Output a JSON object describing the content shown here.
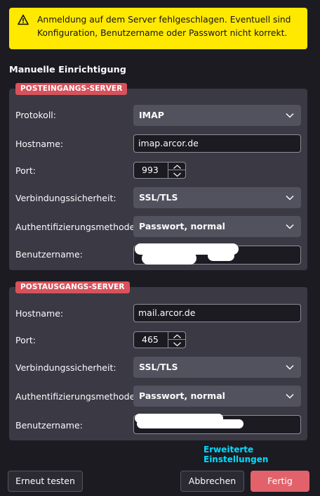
{
  "notice": {
    "text": "Anmeldung auf dem Server fehlgeschlagen. Eventuell sind Konfiguration, Benutzername oder Passwort nicht korrekt."
  },
  "heading": "Manuelle Einrichtigung",
  "incoming": {
    "badge": "POSTEINGANGS-SERVER",
    "protocol_label": "Protokoll:",
    "protocol_value": "IMAP",
    "hostname_label": "Hostname:",
    "hostname_value": "imap.arcor.de",
    "port_label": "Port:",
    "port_value": "993",
    "security_label": "Verbindungssicherheit:",
    "security_value": "SSL/TLS",
    "auth_label": "Authentifizierungsmethode:",
    "auth_value": "Passwort, normal",
    "username_label": "Benutzername:"
  },
  "outgoing": {
    "badge": "POSTAUSGANGS-SERVER",
    "hostname_label": "Hostname:",
    "hostname_value": "mail.arcor.de",
    "port_label": "Port:",
    "port_value": "465",
    "security_label": "Verbindungssicherheit:",
    "security_value": "SSL/TLS",
    "auth_label": "Authentifizierungsmethode:",
    "auth_value": "Passwort, normal",
    "username_label": "Benutzername:"
  },
  "advanced_link": "Erweiterte Einstellungen",
  "buttons": {
    "retest": "Erneut testen",
    "cancel": "Abbrechen",
    "done": "Fertig"
  },
  "colors": {
    "warning_bg": "#ffe900",
    "badge_bg": "#d7525b",
    "link": "#00ddff",
    "primary_button": "#e2626b"
  }
}
